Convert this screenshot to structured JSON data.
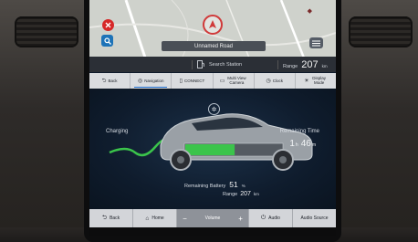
{
  "map": {
    "road_name": "Unnamed Road"
  },
  "station_bar": {
    "search_station": "Search Station",
    "range_label": "Range",
    "range_value": "207",
    "range_unit": "km"
  },
  "tabs": [
    {
      "label": "Back",
      "icon": "back-icon"
    },
    {
      "label": "Navigation",
      "icon": "navigation-icon",
      "active": true
    },
    {
      "label": "CONNECT",
      "icon": "phone-icon"
    },
    {
      "label": "Multi View Camera",
      "icon": "camera-icon"
    },
    {
      "label": "Clock",
      "icon": "clock-icon"
    },
    {
      "label": "Display Mode",
      "icon": "display-mode-icon"
    }
  ],
  "charging": {
    "status_label": "Charging",
    "remaining_time_label": "Remaining Time",
    "remaining_hours": "1",
    "hours_unit": "h",
    "remaining_minutes": "46",
    "minutes_unit": "m",
    "remaining_battery_label": "Remaining Battery",
    "battery_value": "51",
    "battery_unit": "%",
    "battery_fraction": 0.51,
    "range_label": "Range",
    "range_value": "207",
    "range_unit": "km",
    "accent_color": "#3bc44b"
  },
  "bottom_bar": {
    "back": "Back",
    "home": "Home",
    "volume_label": "Volume",
    "volume_minus": "−",
    "volume_plus": "+",
    "audio": "Audio",
    "audio_source": "Audio Source"
  }
}
